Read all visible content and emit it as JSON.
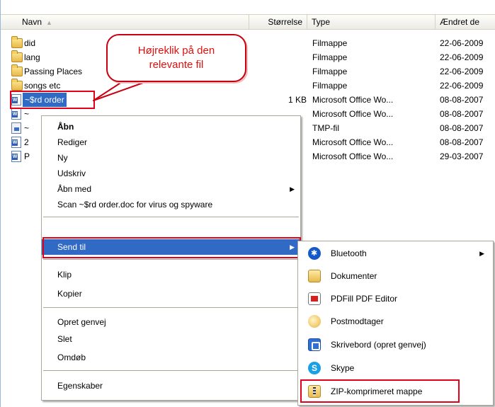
{
  "columns": {
    "name": "Navn",
    "sort_indicator": "▲",
    "size": "Størrelse",
    "type": "Type",
    "modified": "Ændret de"
  },
  "files": [
    {
      "name": "did",
      "size": "",
      "type": "Filmappe",
      "date": "22-06-2009",
      "icon": "folder-icon"
    },
    {
      "name": "lang",
      "size": "",
      "type": "Filmappe",
      "date": "22-06-2009",
      "icon": "folder-icon"
    },
    {
      "name": "Passing Places",
      "size": "",
      "type": "Filmappe",
      "date": "22-06-2009",
      "icon": "folder-icon"
    },
    {
      "name": "songs etc",
      "size": "",
      "type": "Filmappe",
      "date": "22-06-2009",
      "icon": "folder-icon"
    },
    {
      "name": "~$rd order",
      "size": "1 KB",
      "type": "Microsoft Office Wo...",
      "date": "08-08-2007",
      "icon": "word-icon"
    },
    {
      "name": "~",
      "size": "",
      "type": "Microsoft Office Wo...",
      "date": "08-08-2007",
      "icon": "word-icon"
    },
    {
      "name": "~",
      "size": "",
      "type": "TMP-fil",
      "date": "08-08-2007",
      "icon": "tmp-icon"
    },
    {
      "name": "2",
      "size": "",
      "type": "Microsoft Office Wo...",
      "date": "08-08-2007",
      "icon": "word-icon"
    },
    {
      "name": "P",
      "size": "",
      "type": "Microsoft Office Wo...",
      "date": "29-03-2007",
      "icon": "word-icon"
    }
  ],
  "callout": {
    "text": "Højreklik på den\nrelevante fil"
  },
  "context_menu": {
    "items": [
      {
        "label": "Åbn"
      },
      {
        "label": "Rediger"
      },
      {
        "label": "Ny"
      },
      {
        "label": "Udskriv"
      },
      {
        "label": "Åbn med"
      },
      {
        "label": "Scan ~$rd order.doc for virus og spyware"
      },
      {
        "label": "Send til"
      },
      {
        "label": "Klip"
      },
      {
        "label": "Kopier"
      },
      {
        "label": "Opret genvej"
      },
      {
        "label": "Slet"
      },
      {
        "label": "Omdøb"
      },
      {
        "label": "Egenskaber"
      }
    ],
    "submenu_arrow": "▶"
  },
  "send_to_menu": {
    "items": [
      {
        "label": "Bluetooth",
        "icon": "bluetooth-icon"
      },
      {
        "label": "Dokumenter",
        "icon": "documents-folder-icon"
      },
      {
        "label": "PDFill PDF Editor",
        "icon": "pdf-icon"
      },
      {
        "label": "Postmodtager",
        "icon": "mail-recipient-icon"
      },
      {
        "label": "Skrivebord (opret genvej)",
        "icon": "desktop-icon"
      },
      {
        "label": "Skype",
        "icon": "skype-icon",
        "glyph": "S"
      },
      {
        "label": "ZIP-komprimeret mappe",
        "icon": "zip-folder-icon"
      }
    ]
  },
  "colors": {
    "highlight_red": "#e3001b",
    "selection_blue": "#316ac5",
    "callout_text": "#e01010"
  }
}
